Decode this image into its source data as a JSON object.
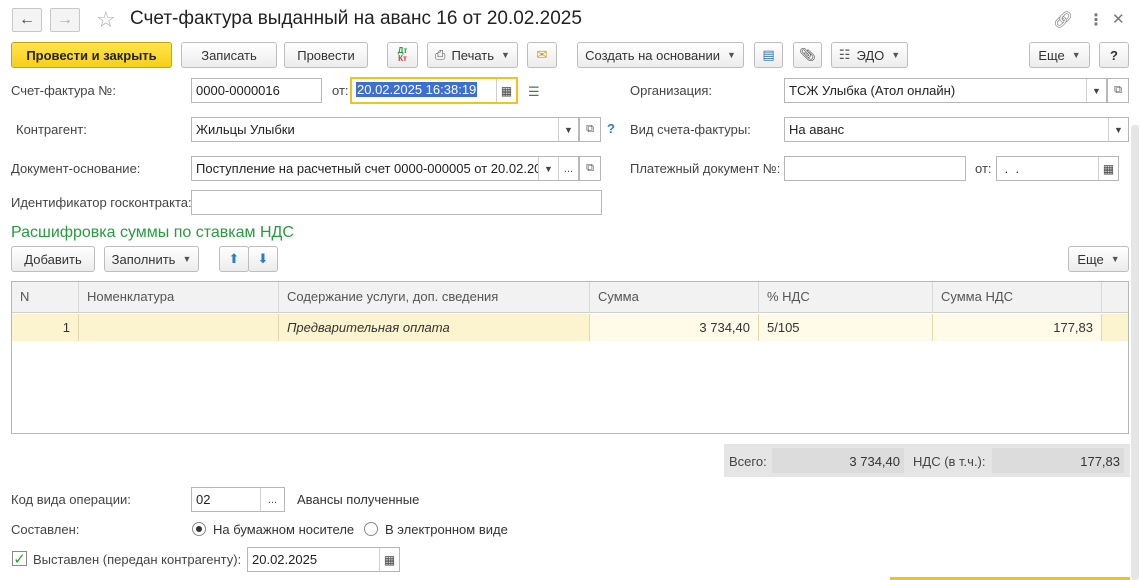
{
  "window": {
    "title": "Счет-фактура выданный на аванс 16 от 20.02.2025",
    "icons": {
      "back": "arrow-left-icon",
      "forward": "arrow-right-icon",
      "favorite": "star-icon",
      "link": "link-icon",
      "menu": "more-vertical-icon",
      "close": "close-icon"
    }
  },
  "toolbar": {
    "post_and_close": "Провести и закрыть",
    "save": "Записать",
    "post": "Провести",
    "print": "Печать",
    "create_based_on": "Создать на основании",
    "edo": "ЭДО",
    "more": "Еще",
    "help": "?"
  },
  "header": {
    "invoice_no_label": "Счет-фактура №:",
    "invoice_no": "0000-0000016",
    "date_label": "от:",
    "date": "20.02.2025 16:38:19",
    "org_label": "Организация:",
    "org": "ТСЖ Улыбка (Атол онлайн)",
    "counterparty_label": "Контрагент:",
    "counterparty": "Жильцы Улыбки",
    "invoice_kind_label": "Вид счета-фактуры:",
    "invoice_kind": "На аванс",
    "base_doc_label": "Документ-основание:",
    "base_doc": "Поступление на расчетный счет 0000-000005 от 20.02.20",
    "pay_doc_label": "Платежный документ №:",
    "pay_doc": "",
    "pay_doc_date_label": "от:",
    "pay_doc_date": " .  .",
    "contract_id_label": "Идентификатор госконтракта:",
    "contract_id": ""
  },
  "section": {
    "title": "Расшифровка суммы по ставкам НДС",
    "add": "Добавить",
    "fill": "Заполнить",
    "more": "Еще"
  },
  "table": {
    "columns": [
      "N",
      "Номенклатура",
      "Содержание услуги, доп. сведения",
      "Сумма",
      "% НДС",
      "Сумма НДС"
    ],
    "rows": [
      {
        "n": "1",
        "nomenclature": "",
        "content": "Предварительная оплата",
        "sum": "3 734,40",
        "vat_rate": "5/105",
        "vat_sum": "177,83"
      }
    ]
  },
  "totals": {
    "total_label": "Всего:",
    "total": "3 734,40",
    "vat_label": "НДС (в т.ч.):",
    "vat": "177,83"
  },
  "footer": {
    "op_code_label": "Код вида операции:",
    "op_code": "02",
    "op_code_desc": "Авансы полученные",
    "compiled_label": "Составлен:",
    "paper": "На бумажном носителе",
    "electronic": "В электронном виде",
    "compiled_selected": "paper",
    "issued_label": "Выставлен (передан контрагенту):",
    "issued_checked": true,
    "issued_date": "20.02.2025"
  },
  "colors": {
    "primary_button": "#f7cf19",
    "section_title": "#2a9a3f",
    "selected_row": "#fcf4cf",
    "selection": "#3d6fd1"
  }
}
